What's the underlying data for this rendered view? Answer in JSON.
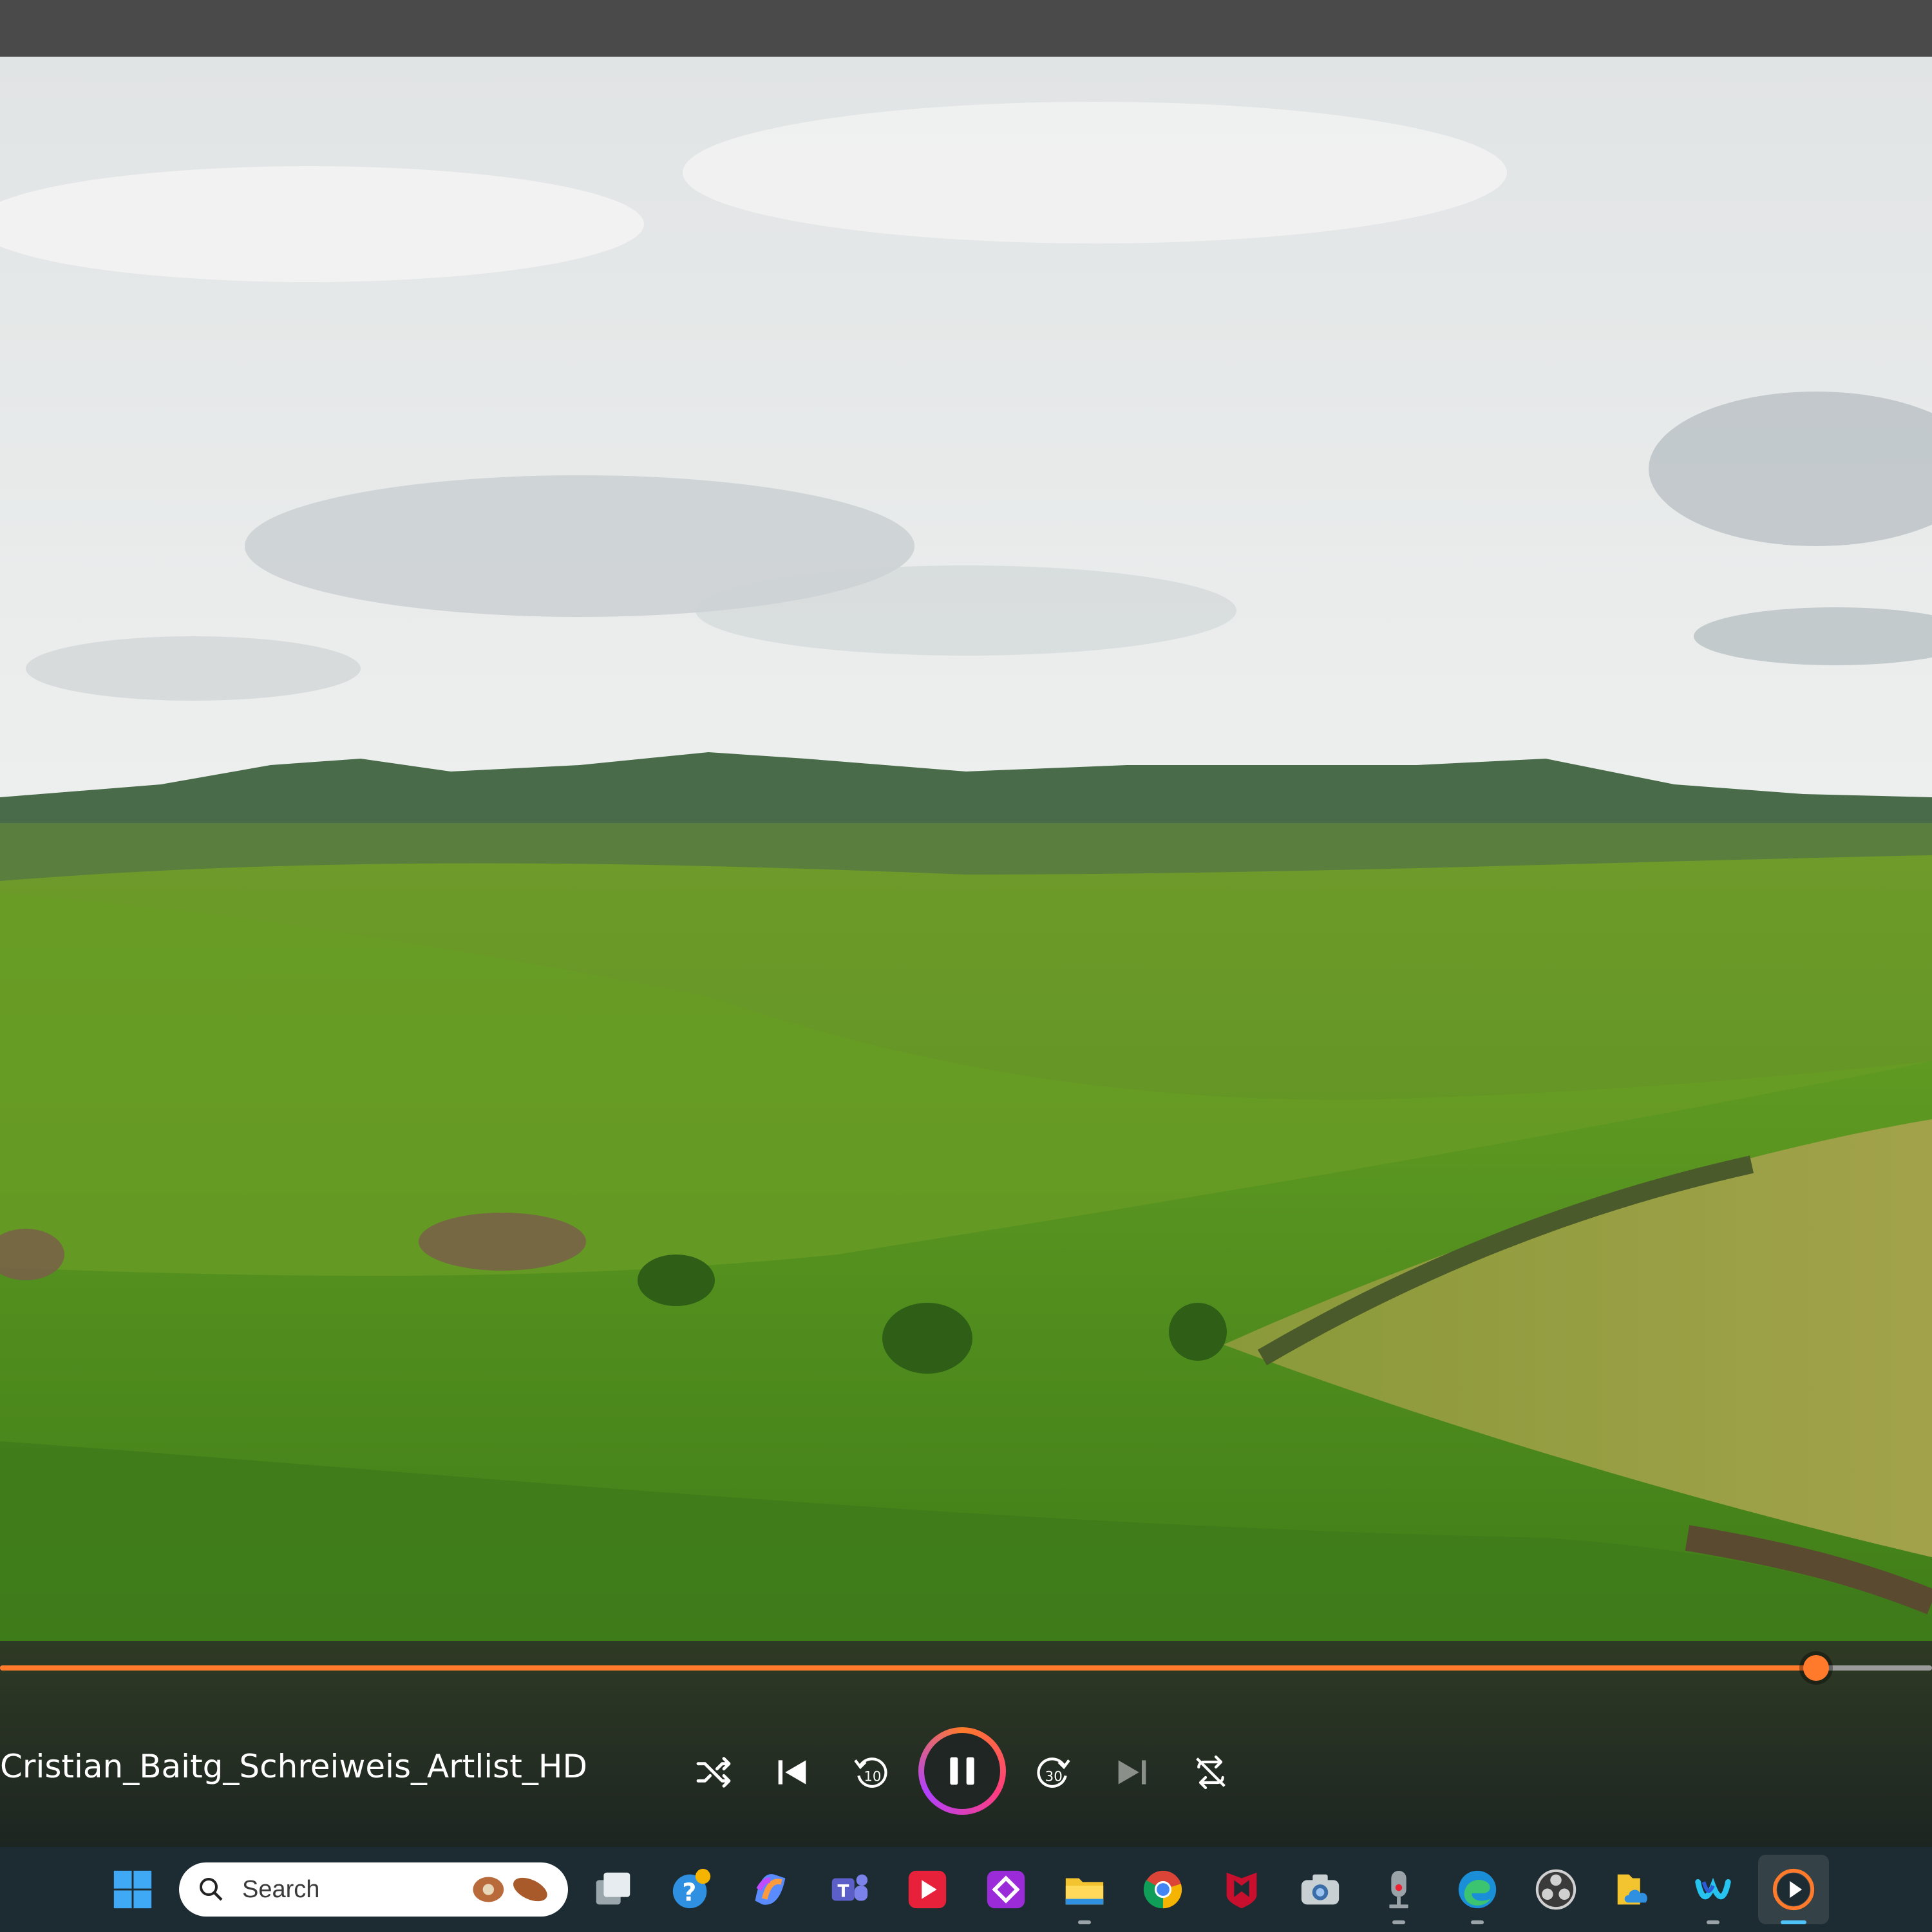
{
  "player": {
    "title": "Cristian_Baitg_Schreiweis_Artlist_HD",
    "progress_fraction": 0.94,
    "accent_color": "#ff7a2a",
    "controls": [
      {
        "name": "shuffle-icon"
      },
      {
        "name": "previous-icon"
      },
      {
        "name": "rewind-10-icon",
        "label": "10"
      },
      {
        "name": "pause-icon"
      },
      {
        "name": "forward-30-icon",
        "label": "30"
      },
      {
        "name": "next-icon"
      },
      {
        "name": "repeat-off-icon"
      }
    ]
  },
  "taskbar": {
    "search_placeholder": "Search",
    "apps": [
      "windows-start-icon",
      "task-view-icon",
      "get-help-icon",
      "copilot-icon",
      "teams-icon",
      "media-player-red-icon",
      "purple-app-icon",
      "file-explorer-icon",
      "chrome-icon",
      "mcafee-icon",
      "camera-icon",
      "voice-recorder-icon",
      "edge-icon",
      "obs-icon",
      "onedrive-folder-icon",
      "webex-icon",
      "media-player-icon"
    ]
  }
}
